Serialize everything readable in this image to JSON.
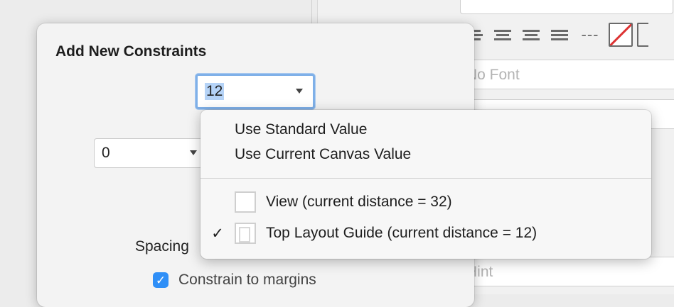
{
  "background": {
    "font_field_placeholder": "No Font",
    "hint_field_placeholder": "Hint"
  },
  "popover": {
    "title": "Add New Constraints",
    "top_value": "12",
    "left_value": "0",
    "spacing_label": "Spacing",
    "constrain_label": "Constrain to margins"
  },
  "menu": {
    "items": [
      "Use Standard Value",
      "Use Current Canvas Value"
    ],
    "views": [
      {
        "label": "View (current distance = 32)",
        "checked": false,
        "icon": "view-thumbnail-icon"
      },
      {
        "label": "Top Layout Guide (current distance = 12)",
        "checked": true,
        "icon": "layout-guide-icon"
      }
    ],
    "check_glyph": "✓"
  },
  "colors": {
    "accent": "#2f8ff7",
    "focus_ring": "#7fb0e8",
    "selection": "#b5d3f7"
  }
}
